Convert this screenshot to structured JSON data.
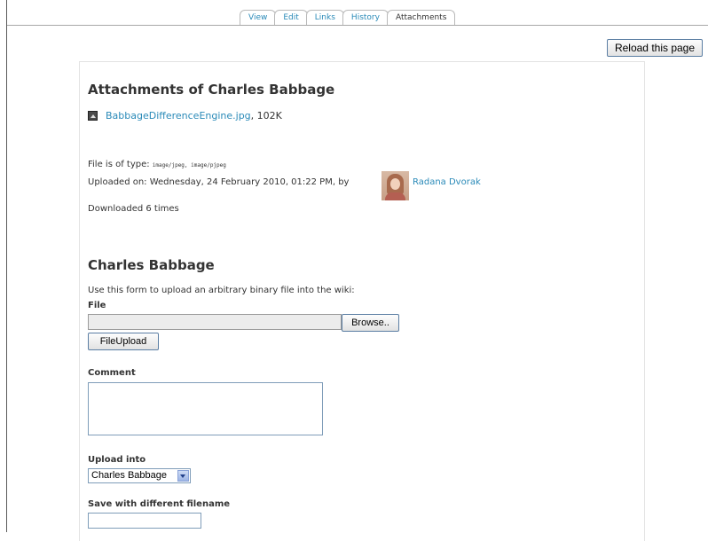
{
  "tabs": [
    "View",
    "Edit",
    "Links",
    "History",
    "Attachments"
  ],
  "reload_button": "Reload this page",
  "attachments": {
    "title": "Attachments of Charles Babbage",
    "file_name": "BabbageDifferenceEngine.jpg",
    "file_size": ", 102K",
    "file_type_label": "File is of type: ",
    "file_type_value": "image/jpeg, image/pjpeg",
    "uploaded_label": "Uploaded on: Wednesday, 24 February 2010, 01:22 PM, by",
    "author": "Radana Dvorak",
    "downloaded": "Downloaded 6 times"
  },
  "form": {
    "title": "Charles Babbage",
    "description": "Use this form to upload an arbitrary binary file into the wiki:",
    "file_label": "File",
    "browse_button": "Browse..",
    "upload_button": "FileUpload",
    "comment_label": "Comment",
    "upload_into_label": "Upload into",
    "upload_into_value": "Charles Babbage",
    "filename_label": "Save with different filename"
  }
}
